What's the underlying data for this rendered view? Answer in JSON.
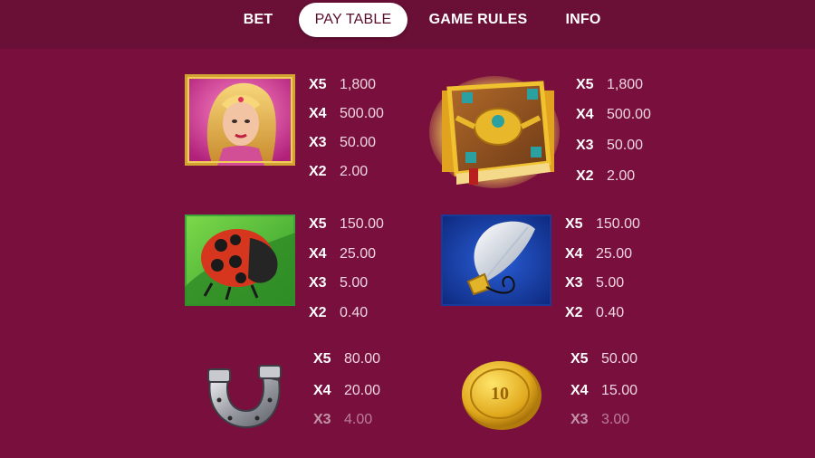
{
  "tabs": [
    {
      "label": "BET",
      "active": false
    },
    {
      "label": "PAY TABLE",
      "active": true
    },
    {
      "label": "GAME RULES",
      "active": false
    },
    {
      "label": "INFO",
      "active": false
    }
  ],
  "colors": {
    "background": "#780f3c",
    "topbar": "#6a0f36",
    "active_tab": "#ffffff"
  },
  "symbols": [
    {
      "name": "queen",
      "payouts": [
        {
          "k": "X5",
          "v": "1,800"
        },
        {
          "k": "X4",
          "v": "500.00"
        },
        {
          "k": "X3",
          "v": "50.00"
        },
        {
          "k": "X2",
          "v": "2.00"
        }
      ]
    },
    {
      "name": "book",
      "payouts": [
        {
          "k": "X5",
          "v": "1,800"
        },
        {
          "k": "X4",
          "v": "500.00"
        },
        {
          "k": "X3",
          "v": "50.00"
        },
        {
          "k": "X2",
          "v": "2.00"
        }
      ]
    },
    {
      "name": "ladybug",
      "payouts": [
        {
          "k": "X5",
          "v": "150.00"
        },
        {
          "k": "X4",
          "v": "25.00"
        },
        {
          "k": "X3",
          "v": "5.00"
        },
        {
          "k": "X2",
          "v": "0.40"
        }
      ]
    },
    {
      "name": "feather",
      "payouts": [
        {
          "k": "X5",
          "v": "150.00"
        },
        {
          "k": "X4",
          "v": "25.00"
        },
        {
          "k": "X3",
          "v": "5.00"
        },
        {
          "k": "X2",
          "v": "0.40"
        }
      ]
    },
    {
      "name": "horseshoe",
      "payouts": [
        {
          "k": "X5",
          "v": "80.00"
        },
        {
          "k": "X4",
          "v": "20.00"
        },
        {
          "k": "X3",
          "v": "4.00"
        }
      ]
    },
    {
      "name": "coin",
      "coin_text": "10",
      "payouts": [
        {
          "k": "X5",
          "v": "50.00"
        },
        {
          "k": "X4",
          "v": "15.00"
        },
        {
          "k": "X3",
          "v": "3.00"
        }
      ]
    }
  ]
}
